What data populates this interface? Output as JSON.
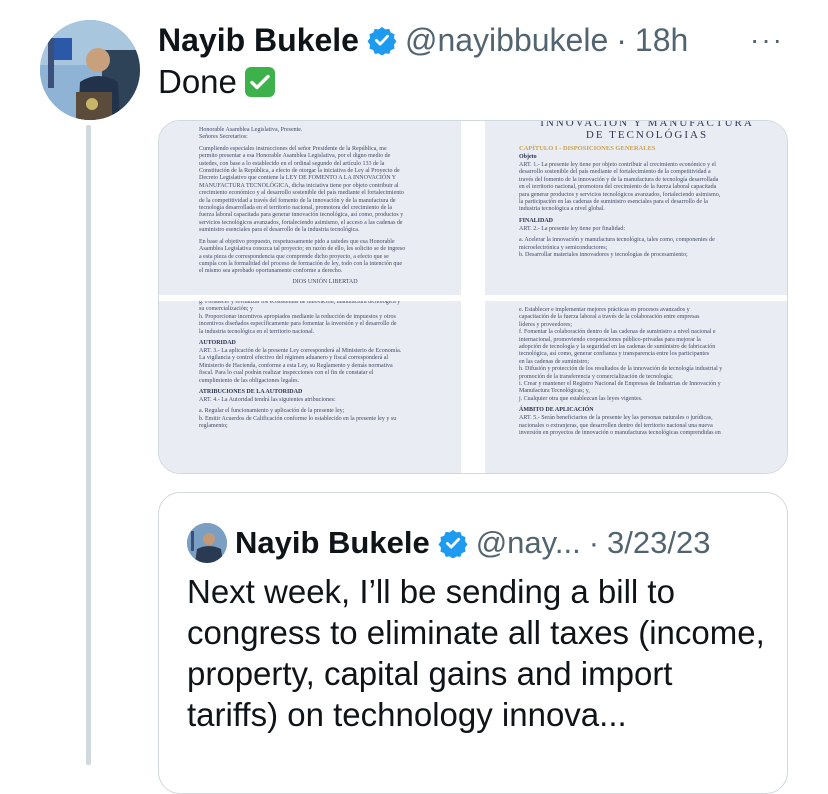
{
  "tweet": {
    "author_name": "Nayib Bukele",
    "handle": "@nayibbukele",
    "separator": "·",
    "time": "18h",
    "more_label": "···",
    "text": "Done"
  },
  "media": {
    "doc1": {
      "lines": [
        "Honorable Asamblea Legislativa, Presente.",
        "Señores Secretarios:",
        "",
        "Cumpliendo especiales instrucciones del señor Presidente de la República, me",
        "permito presentar a esa Honorable Asamblea Legislativa, por el digno medio de",
        "ustedes, con base a lo establecido en el ordinal segundo del artículo 133 de la",
        "Constitución de la República, a efecto de otorgar la iniciativa de Ley al Proyecto de",
        "Decreto Legislativo que contiene la LEY DE FOMENTO A LA INNOVACIÓN Y",
        "MANUFACTURA TECNOLÓGICA, dicha iniciativa tiene por objeto contribuir al",
        "crecimiento económico y al desarrollo sostenible del país mediante el fortalecimiento",
        "de la competitividad a través del fomento de la innovación y de la manufactura de",
        "tecnología desarrollada en el territorio nacional, promotora del crecimiento de la",
        "fuerza laboral capacitada para generar innovación tecnológica, así como, productos y",
        "servicios tecnológicos avanzados, fortaleciendo asimismo, el acceso a las cadenas de",
        "suministro esenciales para el desarrollo de la industria tecnológica.",
        "",
        "En base al objetivo propuesto, respetuosamente pido a ustedes que esa Honorable",
        "Asamblea Legislativa conozca tal proyecto; en razón de ello, les solicito se de ingreso",
        "a esta pieza de correspondencia que comprende dicho proyecto, a efecto que se",
        "cumpla con la formalidad del proceso de formación de ley, todo con la intención que",
        "el mismo sea aprobado oportunamente conforme a derecho."
      ],
      "closing": "DIOS UNIÓN LIBERTAD"
    },
    "doc2": {
      "title_top": "INNOVACIÓN Y MANUFACTURA",
      "title_bottom": "DE TECNOLÓGIAS",
      "chapter": "CAPÍTULO I - DISPOSICIONES GENERALES",
      "objeto_heading": "Objeto",
      "objeto_lines": [
        "ART. 1.- La presente ley tiene por objeto contribuir al crecimiento económico y el",
        "desarrollo sostenible del país mediante el fortalecimiento de la competitividad a",
        "través del fomento de la innovación y de la manufactura de tecnología desarrollada",
        "en el territorio nacional, promotora del crecimiento de la fuerza laboral capacitada",
        "para generar productos y servicios tecnológicos avanzados, fortaleciendo asimismo,",
        "la participación en las cadenas de suministro esenciales para el desarrollo de la",
        "industria tecnológica a nivel global."
      ],
      "finalidad_heading": "FINALIDAD",
      "finalidad_lines": [
        "ART. 2.- La presente ley tiene por finalidad:",
        "",
        "a. Acelerar la innovación y manufactura tecnológica, tales como, componentes de",
        "    microelectrónica y semiconductores;",
        "b. Desarrollar materiales innovadores y tecnologías de procesamiento;"
      ]
    },
    "doc3": {
      "lines_top": [
        "g. Fortalecer y revitalizar los ecosistemas de innovación, manufactura tecnológica y",
        "    su comercialización; y",
        "h. Proporcionar incentivos apropiados mediante la reducción de impuestos y otros",
        "    incentivos diseñados específicamente para fomentar la inversión y el desarrollo de",
        "    la industria tecnológica en el territorio nacional."
      ],
      "autoridad_heading": "AUTORIDAD",
      "autoridad_lines": [
        "ART. 3.- La aplicación de la presente Ley corresponderá al Ministerio de Economía.",
        "La vigilancia y control efectivo del régimen aduanero y fiscal corresponderá al",
        "Ministerio de Hacienda, conforme a esta Ley, su Reglamento y demás normativa",
        "fiscal. Para lo cual podrán realizar inspecciones con el fin de constatar el",
        "cumplimiento de las obligaciones legales."
      ],
      "atribuciones_heading": "ATRIBUCIONES DE LA AUTORIDAD",
      "atribuciones_lines": [
        "ART. 4.- La Autoridad tendrá las siguientes atribuciones:",
        "",
        "a. Regular el funcionamiento y aplicación de la presente ley;",
        "b. Emitir Acuerdos de Calificación conforme lo establecido en la presente ley y su",
        "    reglamento;"
      ]
    },
    "doc4": {
      "lines_top": [
        "e. Establecer e implementar mejores prácticas en procesos avanzados y",
        "    capacitación de la fuerza laboral a través de la colaboración entre empresas",
        "    líderes y proveedores;",
        "f. Fomentar la colaboración dentro de las cadenas de suministro a nivel nacional e",
        "    internacional, promoviendo cooperaciones público-privadas para mejorar la",
        "    adopción de tecnología y la seguridad en las cadenas de suministro de fabricación",
        "    tecnológica, así como, generar confianza y transparencia entre los participantes",
        "    en las cadenas de suministro;",
        "h. Difusión y protección de los resultados de la innovación de tecnología industrial y",
        "    promoción de la transferencia y comercialización de tecnología;",
        "i. Crear y mantener el Registro Nacional de Empresas de Industrias de Innovación y",
        "    Manufactura Tecnológicas; y,",
        "j. Cualquier otra que establezcan las leyes vigentes."
      ],
      "ambito_heading": "ÁMBITO DE APLICACIÓN",
      "ambito_lines": [
        "ART. 5.- Serán beneficiarios de la presente ley las personas naturales o jurídicas,",
        "nacionales o extranjeras, que desarrollen dentro del territorio nacional una nueva",
        "inversión en proyectos de innovación o manufacturas tecnológicas comprendidas en"
      ]
    }
  },
  "quoted_tweet": {
    "author_name": "Nayib Bukele",
    "handle": "@nay...",
    "separator": "·",
    "date": "3/23/23",
    "text": "Next week, I’ll be sending a bill to congress to eliminate all taxes (income, property, capital gains and import tariffs) on technology innova..."
  },
  "colors": {
    "verified_blue": "#1d9bf0",
    "secondary_text": "#536471",
    "thread_line": "#cfd9de",
    "doc_background": "#e9ecf3"
  },
  "icons": {
    "verified": "verified-badge-icon",
    "check_emoji": "check-mark-button-emoji",
    "more": "more-options-icon"
  }
}
